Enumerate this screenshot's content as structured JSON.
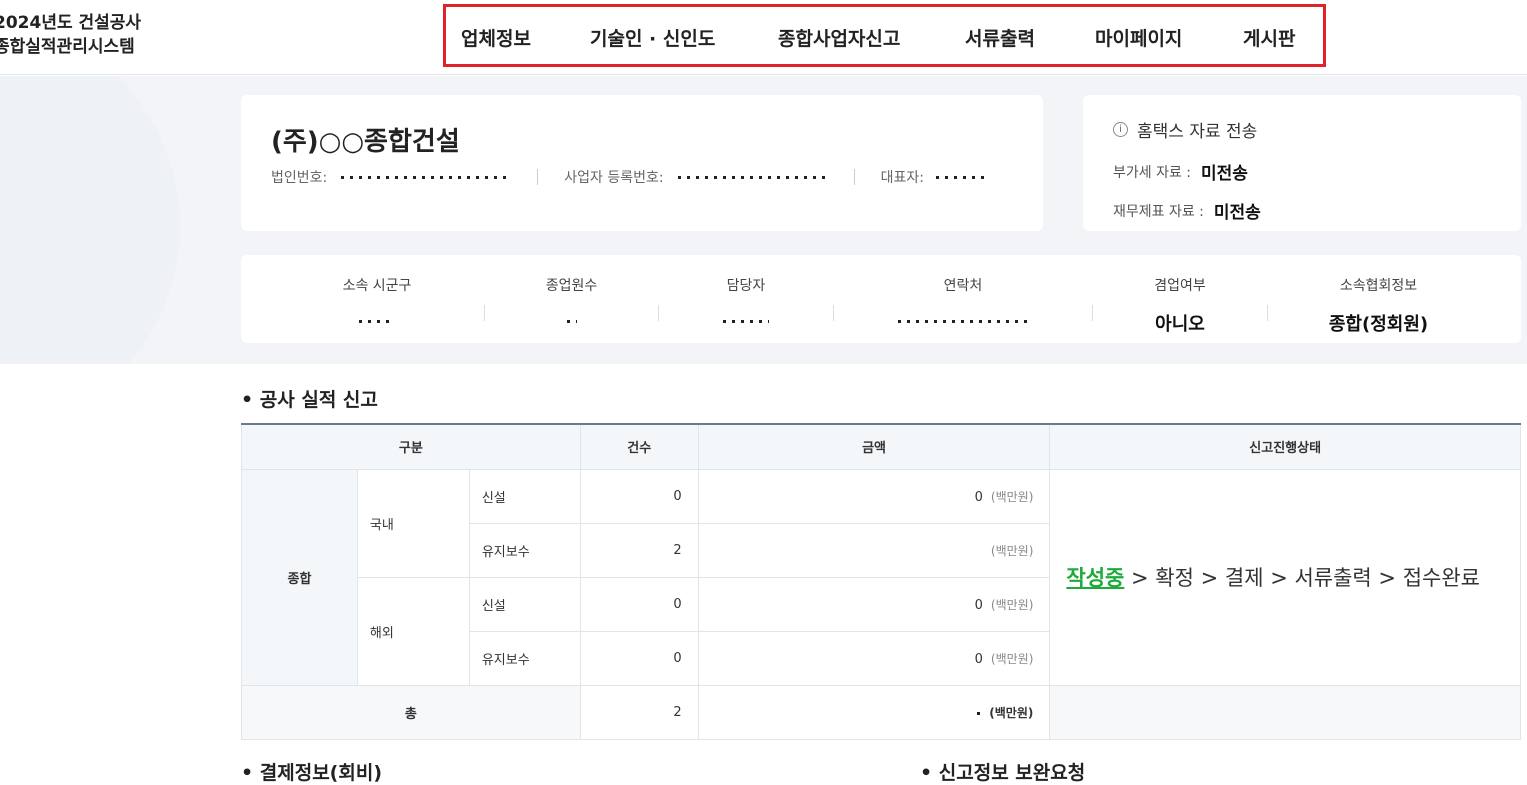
{
  "logo": {
    "line1": "2024년도 건설공사",
    "line2": "종합실적관리시스템"
  },
  "nav": [
    "업체정보",
    "기술인 · 신인도",
    "종합사업자신고",
    "서류출력",
    "마이페이지",
    "게시판"
  ],
  "company": {
    "name": "(주)○○종합건설",
    "corp_no_label": "법인번호:",
    "biz_no_label": "사업자 등록번호:",
    "ceo_label": "대표자:"
  },
  "hometax": {
    "title": "홈택스 자료 전송",
    "vat_label": "부가세 자료 :",
    "vat_value": "미전송",
    "fin_label": "재무제표 자료 :",
    "fin_value": "미전송"
  },
  "stats": {
    "region_label": "소속 시군구",
    "employees_label": "종업원수",
    "manager_label": "담당자",
    "contact_label": "연락처",
    "sideline_label": "겸업여부",
    "sideline_value": "아니오",
    "assoc_label": "소속협회정보",
    "assoc_value": "종합(정회원)"
  },
  "performance": {
    "title": "• 공사 실적 신고",
    "headers": {
      "category": "구분",
      "count": "건수",
      "amount": "금액",
      "status": "신고진행상태"
    },
    "group": "종합",
    "domestic": "국내",
    "overseas": "해외",
    "new": "신설",
    "maintenance": "유지보수",
    "unit": "(백만원)",
    "rows": [
      {
        "count": "0",
        "amount": "0"
      },
      {
        "count": "2",
        "amount": ""
      },
      {
        "count": "0",
        "amount": "0"
      },
      {
        "count": "0",
        "amount": "0"
      }
    ],
    "total_label": "총",
    "total_count": "2",
    "status_steps": {
      "current": "작성중",
      "rest": " > 확정 > 결제 > 서류출력 > 접수완료"
    }
  },
  "payment_title": "• 결제정보(회비)",
  "supplement_title": "• 신고정보 보완요청"
}
